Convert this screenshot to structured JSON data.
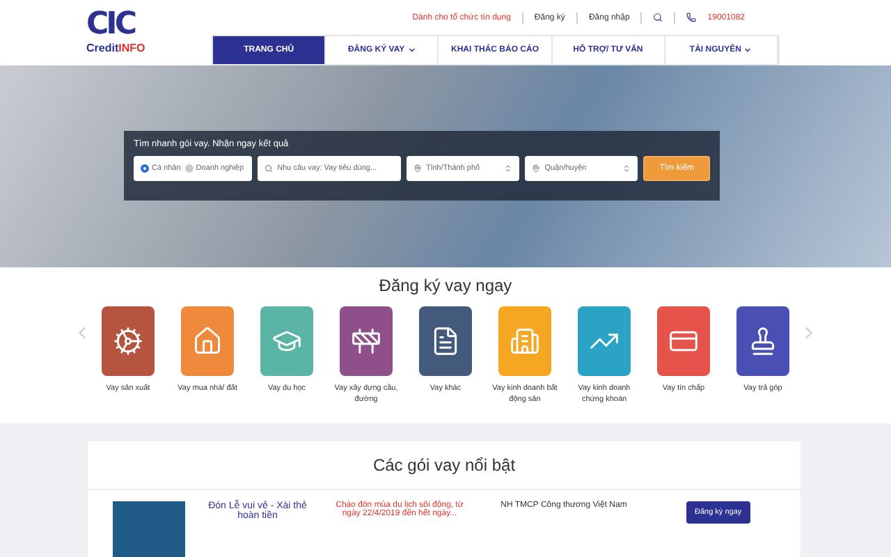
{
  "header": {
    "top_links": [
      "Dành cho tổ chức tín dụng",
      "Đăng ký",
      "Đăng nhập"
    ],
    "phone": "19001082",
    "logo": {
      "brand": "CIC",
      "sub_a": "Credit",
      "sub_b": "INFO"
    }
  },
  "nav": [
    {
      "label": "TRANG CHỦ",
      "selected": true,
      "dropdown": false
    },
    {
      "label": "ĐĂNG KÝ VAY",
      "selected": false,
      "dropdown": true
    },
    {
      "label": "KHAI THÁC BÁO CÁO",
      "selected": false,
      "dropdown": false
    },
    {
      "label": "HỖ TRỢ/ TƯ VẤN",
      "selected": false,
      "dropdown": false
    },
    {
      "label": "TÀI NGUYÊN",
      "selected": false,
      "dropdown": true
    }
  ],
  "search": {
    "title": "Tìm nhanh gói vay. Nhận ngay kết quả",
    "options": [
      {
        "label": "Cá nhân",
        "selected": true
      },
      {
        "label": "Doanh nghiệp",
        "selected": false
      }
    ],
    "need_placeholder": "Nhu cầu vay: Vay tiêu dùng...",
    "province": "Tỉnh/Thành phố",
    "district": "Quận/huyện",
    "button": "Tìm kiếm"
  },
  "loan_types": {
    "title": "Đăng ký vay ngay",
    "items": [
      {
        "label": "Vay sản xuất",
        "color": "#b5553f"
      },
      {
        "label": "Vay mua nhà/ đất",
        "color": "#ef8a3c"
      },
      {
        "label": "Vay du học",
        "color": "#5bb5a6"
      },
      {
        "label": "Vay xây dựng cầu, đường",
        "color": "#8e4f8b"
      },
      {
        "label": "Vay khác",
        "color": "#445a7c"
      },
      {
        "label": "Vay kinh doanh bất động sản",
        "color": "#f5a623"
      },
      {
        "label": "Vay kinh doanh chứng khoán",
        "color": "#2aa3c4"
      },
      {
        "label": "Vay tín chấp",
        "color": "#e5534b"
      },
      {
        "label": "Vay trả góp",
        "color": "#4a4fb3"
      }
    ]
  },
  "featured": {
    "title": "Các gói vay nổi bật",
    "rows": [
      {
        "name": "Đón Lễ vui vẻ - Xài thẻ hoàn tiền",
        "promo": "Chào đón mùa du lịch sôi động, từ ngày 22/4/2019 đến hết ngày...",
        "bank": "NH TMCP Công thương Việt Nam",
        "button": "Đăng ký ngay"
      }
    ]
  }
}
